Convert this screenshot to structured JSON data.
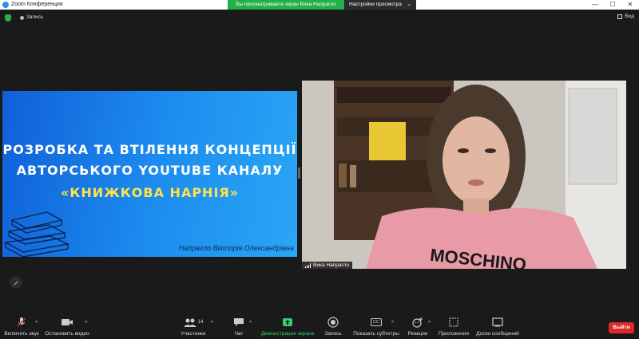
{
  "titlebar": {
    "app_title": "Zoom Конференция",
    "share_message": "Вы просматриваете экран Вика Напрагло",
    "view_options": "Настройки просмотра",
    "view_options_caret": "⌄",
    "minimize": "—",
    "maximize": "☐",
    "close": "✕"
  },
  "recording": {
    "label": "Запись",
    "view_label": "Вид"
  },
  "slide": {
    "line1": "РОЗРОБКА ТА ВТІЛЕННЯ КОНЦЕПЦІЇ",
    "line2": "АВТОРСЬКОГО YOUTUBE КАНАЛУ",
    "line3": "«КНИЖКОВА НАРНІЯ»",
    "author": "Напрягло Вікторія Олександрівна"
  },
  "video": {
    "participant_name": "Вика Напрагло"
  },
  "toolbar": {
    "mute_label": "Включить звук",
    "video_label": "Остановить видео",
    "participants_label": "Участники",
    "participants_count": "14",
    "chat_label": "Чат",
    "share_label": "Демонстрация экрана",
    "record_label": "Запись",
    "captions_label": "Показать субтитры",
    "captions_badge": "CC",
    "reactions_label": "Реакции",
    "apps_label": "Приложения",
    "whiteboard_label": "Доски сообщений",
    "caret": "^",
    "exit_label": "Выйти"
  },
  "colors": {
    "accent_green": "#23b04a",
    "exit_red": "#e02828",
    "slide_blue": "#1d8ef0",
    "slide_yellow": "#ffe34a"
  }
}
